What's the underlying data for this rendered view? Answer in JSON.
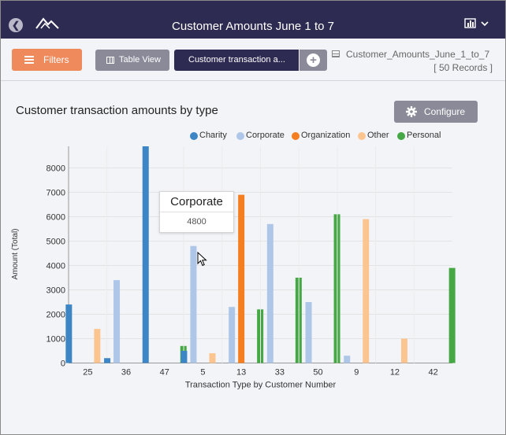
{
  "header": {
    "title": "Customer Amounts June 1 to 7"
  },
  "toolbar": {
    "filters_label": "Filters",
    "table_view_label": "Table View",
    "active_tab_label": "Customer transaction a...",
    "dataset_name": "Customer_Amounts_June_1_to_7",
    "record_count": "[ 50 Records ]"
  },
  "panel": {
    "title": "Customer transaction amounts by type",
    "configure_label": "Configure"
  },
  "tooltip": {
    "title": "Corporate",
    "value": "4800"
  },
  "legend": [
    {
      "name": "Charity",
      "color": "#3d86c6"
    },
    {
      "name": "Corporate",
      "color": "#aec7e8"
    },
    {
      "name": "Organization",
      "color": "#f57e20"
    },
    {
      "name": "Other",
      "color": "#fcc590"
    },
    {
      "name": "Personal",
      "color": "#45a845"
    }
  ],
  "icons": {
    "back": "back-arrow-circle-icon",
    "logo": "mountain-logo-icon",
    "chart_menu": "bar-chart-dropdown-icon",
    "filters": "hamburger-icon",
    "table_view": "grid-icon",
    "add": "plus-circle-icon",
    "dataset": "table-icon",
    "configure": "gear-icon"
  },
  "chart_data": {
    "type": "bar",
    "xlabel": "Transaction Type by Customer Number",
    "ylabel": "Amount (Total)",
    "ylim": [
      0,
      8900
    ],
    "yticks": [
      0,
      1000,
      2000,
      3000,
      4000,
      5000,
      6000,
      7000,
      8000
    ],
    "grid": true,
    "categories": [
      "25",
      "36",
      "47",
      "5",
      "13",
      "33",
      "50",
      "9",
      "12",
      "42"
    ],
    "series": [
      {
        "name": "Charity",
        "color": "#3d86c6",
        "values": [
          2400,
          200,
          8900,
          500,
          0,
          0,
          0,
          0,
          0,
          0
        ]
      },
      {
        "name": "Corporate",
        "color": "#aec7e8",
        "values": [
          0,
          3400,
          0,
          4800,
          2300,
          5700,
          2500,
          300,
          0,
          0
        ]
      },
      {
        "name": "Organization",
        "color": "#f57e20",
        "values": [
          0,
          0,
          0,
          0,
          6900,
          0,
          0,
          0,
          0,
          0
        ]
      },
      {
        "name": "Other",
        "color": "#fcc590",
        "values": [
          1400,
          0,
          0,
          400,
          0,
          0,
          0,
          5900,
          1000,
          0
        ]
      },
      {
        "name": "Personal",
        "color": "#45a845",
        "values": [
          0,
          0,
          700,
          0,
          2200,
          3500,
          6100,
          0,
          0,
          3900
        ]
      }
    ]
  }
}
